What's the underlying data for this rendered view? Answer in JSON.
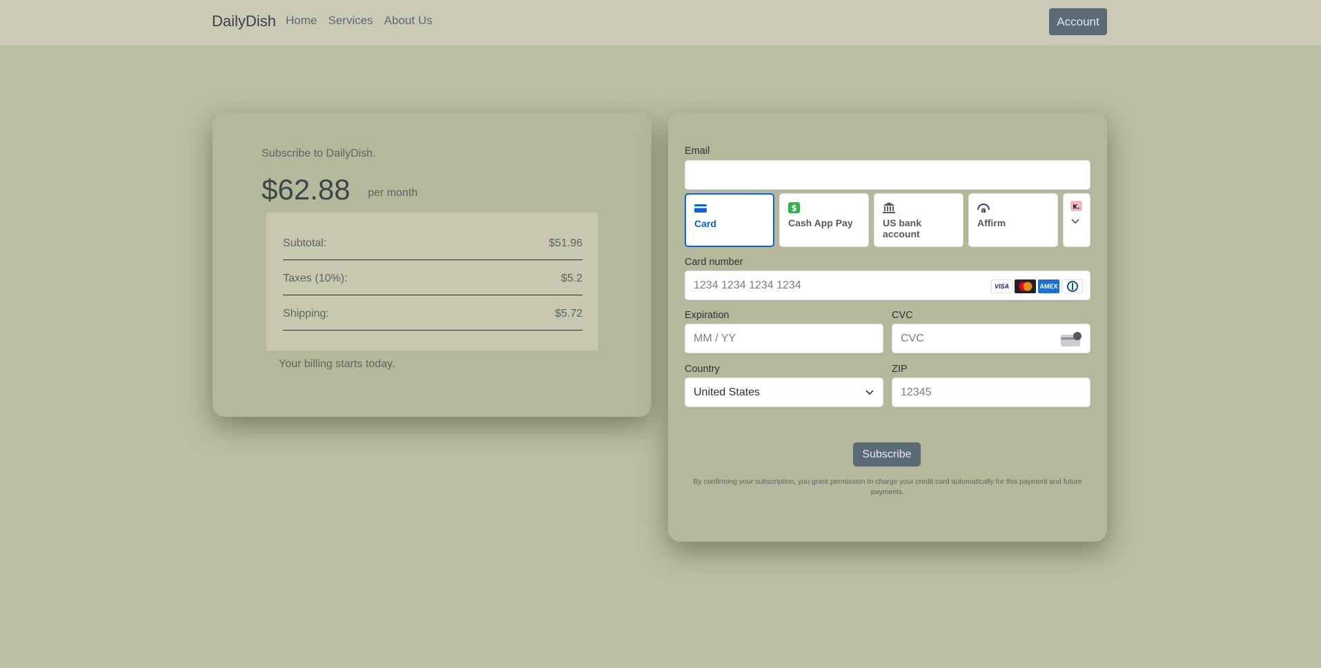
{
  "nav": {
    "brand": "DailyDish",
    "links": [
      "Home",
      "Services",
      "About Us"
    ],
    "account_label": "Account"
  },
  "summary": {
    "subtitle": "Subscribe to DailyDish.",
    "price": "$62.88",
    "period": "per month",
    "rows": [
      {
        "label": "Subtotal:",
        "value": "$51.96"
      },
      {
        "label": "Taxes (10%):",
        "value": "$5.2"
      },
      {
        "label": "Shipping:",
        "value": "$5.72"
      }
    ],
    "billing_note": "Your billing starts today."
  },
  "payment": {
    "email_label": "Email",
    "email_value": "",
    "methods": [
      {
        "label": "Card",
        "icon": "card-icon",
        "active": true
      },
      {
        "label": "Cash App Pay",
        "icon": "cashapp-icon",
        "active": false
      },
      {
        "label": "US bank account",
        "icon": "bank-icon",
        "active": false
      },
      {
        "label": "Affirm",
        "icon": "affirm-icon",
        "active": false
      },
      {
        "label": "",
        "icon": "klarna-icon",
        "active": false
      }
    ],
    "card_number_label": "Card number",
    "card_number_placeholder": "1234 1234 1234 1234",
    "card_brands": [
      "VISA",
      "Mastercard",
      "AMEX",
      "Diners"
    ],
    "expiration_label": "Expiration",
    "expiration_placeholder": "MM / YY",
    "cvc_label": "CVC",
    "cvc_placeholder": "CVC",
    "country_label": "Country",
    "country_value": "United States",
    "zip_label": "ZIP",
    "zip_placeholder": "12345",
    "subscribe_label": "Subscribe",
    "legal_text": "By confirming your subscription, you grant permission to charge your credit card automatically for this payment and future payments."
  },
  "colors": {
    "background": "#bcbfa3",
    "navbar": "#cbcab4",
    "card": "#b6b89c",
    "button": "#5a6a76",
    "active_method": "#0a63d6"
  }
}
